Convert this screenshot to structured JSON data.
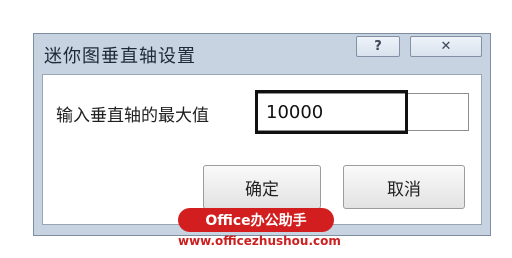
{
  "dialog": {
    "title": "迷你图垂直轴设置",
    "help_glyph": "?",
    "close_glyph": "✕",
    "field": {
      "label": "输入垂直轴的最大值",
      "value": "10000"
    },
    "ok_label": "确定",
    "cancel_label": "取消"
  },
  "watermark": {
    "badge": "Office办公助手",
    "url": "www.officezhushou.com"
  },
  "icons": {
    "help": "question-mark-icon",
    "close": "close-icon"
  }
}
